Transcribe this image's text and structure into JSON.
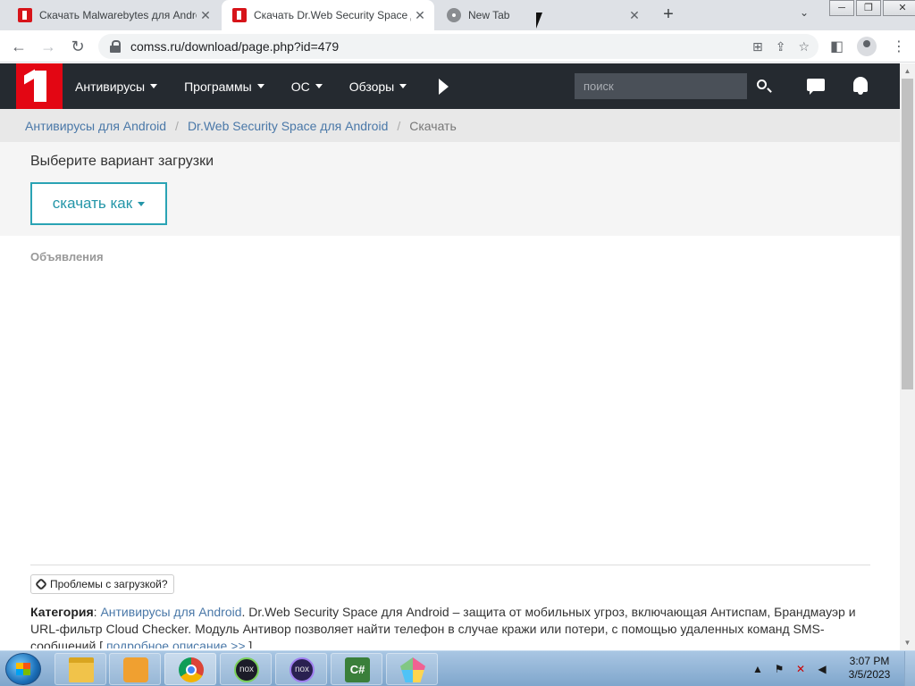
{
  "browser": {
    "tabs": [
      {
        "title": "Скачать Malwarebytes для Android",
        "icon": "comss-favicon"
      },
      {
        "title": "Скачать Dr.Web Security Space для Android",
        "icon": "comss-favicon"
      },
      {
        "title": "New Tab",
        "icon": "chrome-favicon"
      }
    ],
    "close_glyph": "✕",
    "new_tab_glyph": "+",
    "address": "comss.ru/download/page.php?id=479"
  },
  "site": {
    "menu": [
      "Антивирусы",
      "Программы",
      "ОС",
      "Обзоры"
    ],
    "search_placeholder": "поиск",
    "colors": {
      "header_bg": "#252a30",
      "logo_red": "#e30613",
      "accent_teal": "#2aa3b4",
      "link_blue": "#4a78a8"
    }
  },
  "breadcrumb": {
    "items": [
      "Антивирусы для Android",
      "Dr.Web Security Space для Android"
    ],
    "separator": "/",
    "current": "Скачать"
  },
  "download": {
    "heading": "Выберите вариант загрузки",
    "button_label": "скачать как"
  },
  "ads_label": "Объявления",
  "footer": {
    "problems_label": "Проблемы с загрузкой?",
    "category_label": "Категория",
    "category_link": "Антивирусы для Android",
    "description": ". Dr.Web Security Space для Android – защита от мобильных угроз, включающая Антиспам, Брандмауэр и URL-фильтр Cloud Checker. Модуль Антивор позволяет найти телефон в случае кражи или потери, с помощью удаленных команд SMS-сообщений [ ",
    "more_link": "подробное описание >>",
    "close_bracket": " ]"
  },
  "taskbar": {
    "apps": [
      "explorer",
      "media-player",
      "chrome",
      "nox",
      "multi-nox",
      "csharp-editor",
      "gem-app"
    ],
    "nox_text": "nox",
    "cs_text": "C#",
    "time": "3:07 PM",
    "date": "3/5/2023"
  }
}
